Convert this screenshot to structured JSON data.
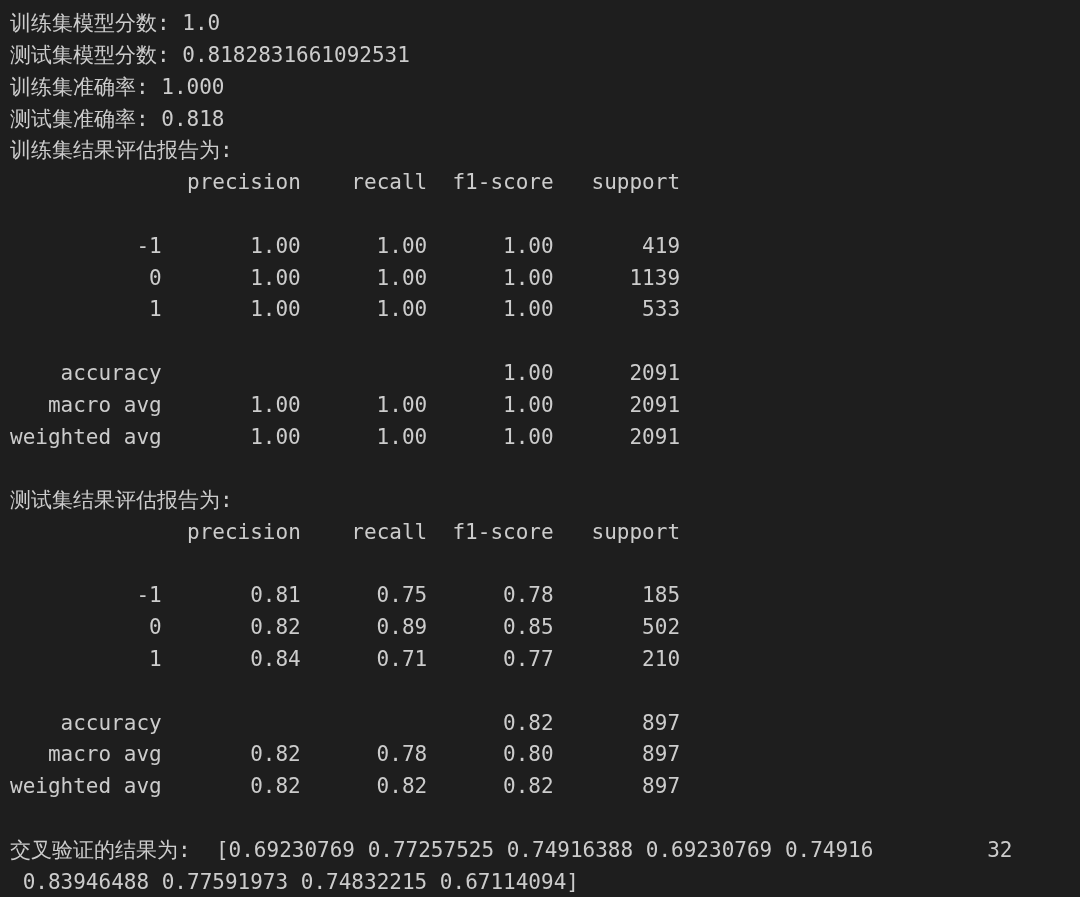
{
  "summary_lines": [
    {
      "label": "训练集模型分数:",
      "value": "1.0"
    },
    {
      "label": "测试集模型分数:",
      "value": "0.8182831661092531"
    },
    {
      "label": "训练集准确率:",
      "value": "1.000"
    },
    {
      "label": "测试集准确率:",
      "value": "0.818"
    }
  ],
  "reports": [
    {
      "title": "训练集结果评估报告为:",
      "columns": [
        "precision",
        "recall",
        "f1-score",
        "support"
      ],
      "groups": [
        [
          {
            "label": "-1",
            "cells": [
              "1.00",
              "1.00",
              "1.00",
              "419"
            ]
          },
          {
            "label": "0",
            "cells": [
              "1.00",
              "1.00",
              "1.00",
              "1139"
            ]
          },
          {
            "label": "1",
            "cells": [
              "1.00",
              "1.00",
              "1.00",
              "533"
            ]
          }
        ],
        [
          {
            "label": "accuracy",
            "cells": [
              null,
              null,
              "1.00",
              "2091"
            ]
          },
          {
            "label": "macro avg",
            "cells": [
              "1.00",
              "1.00",
              "1.00",
              "2091"
            ]
          },
          {
            "label": "weighted avg",
            "cells": [
              "1.00",
              "1.00",
              "1.00",
              "2091"
            ]
          }
        ]
      ]
    },
    {
      "title": "测试集结果评估报告为:",
      "columns": [
        "precision",
        "recall",
        "f1-score",
        "support"
      ],
      "groups": [
        [
          {
            "label": "-1",
            "cells": [
              "0.81",
              "0.75",
              "0.78",
              "185"
            ]
          },
          {
            "label": "0",
            "cells": [
              "0.82",
              "0.89",
              "0.85",
              "502"
            ]
          },
          {
            "label": "1",
            "cells": [
              "0.84",
              "0.71",
              "0.77",
              "210"
            ]
          }
        ],
        [
          {
            "label": "accuracy",
            "cells": [
              null,
              null,
              "0.82",
              "897"
            ]
          },
          {
            "label": "macro avg",
            "cells": [
              "0.82",
              "0.78",
              "0.80",
              "897"
            ]
          },
          {
            "label": "weighted avg",
            "cells": [
              "0.82",
              "0.82",
              "0.82",
              "897"
            ]
          }
        ]
      ]
    }
  ],
  "cross_validation": {
    "label": "交叉验证的结果为:",
    "line_1": "[0.69230769 0.77257525 0.74916388 0.69230769 0.74916",
    "line_1_end": "32",
    "line_2": "0.83946488 0.77591973 0.74832215 0.67114094]"
  }
}
